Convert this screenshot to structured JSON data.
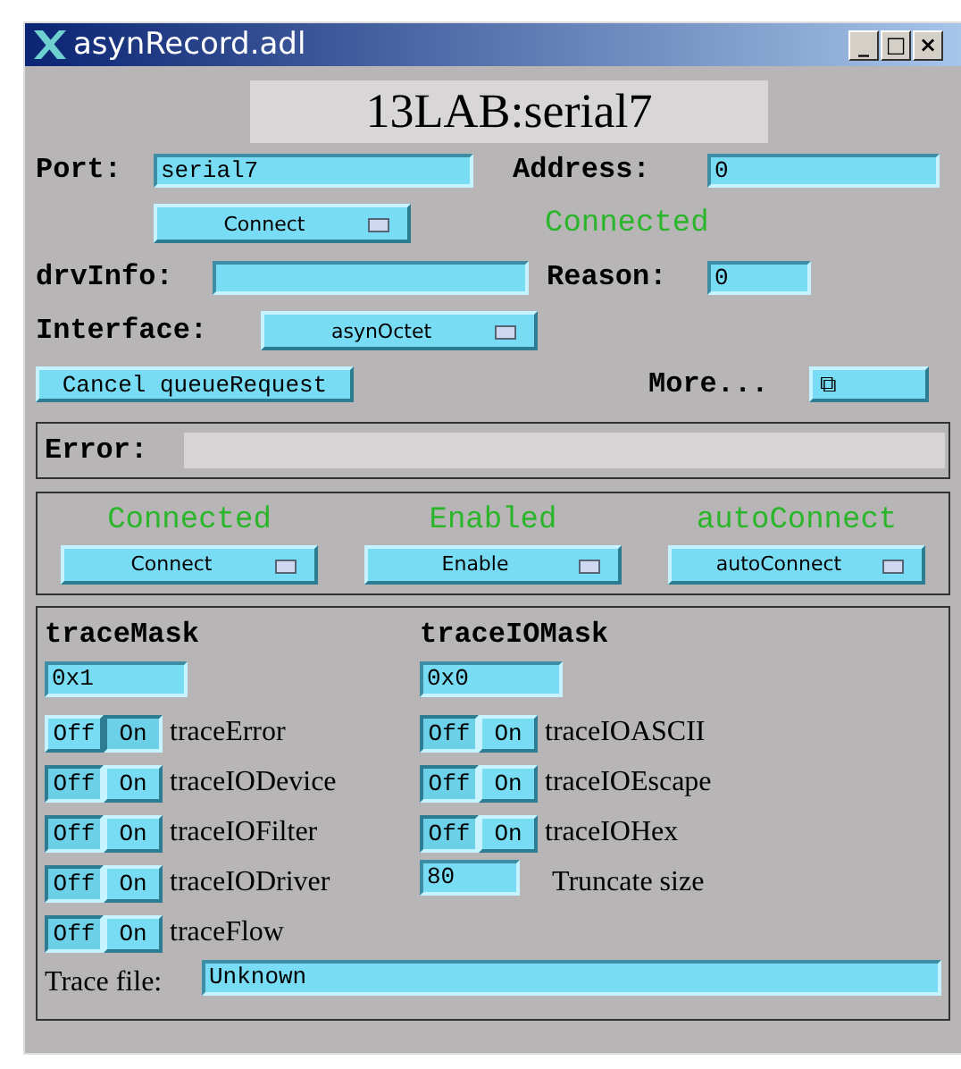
{
  "window": {
    "title": "asynRecord.adl",
    "controls": [
      "_",
      "□",
      "×"
    ]
  },
  "record_name": "13LAB:serial7",
  "port": {
    "label": "Port:",
    "value": "serial7"
  },
  "address": {
    "label": "Address:",
    "value": "0"
  },
  "connect_menu": "Connect",
  "connection_status": "Connected",
  "drvinfo": {
    "label": "drvInfo:"
  },
  "reason": {
    "label": "Reason:",
    "value": "0"
  },
  "interface": {
    "label": "Interface:",
    "menu": "asynOctet"
  },
  "cancel_button": "Cancel queueRequest",
  "more": {
    "label": "More...",
    "button": "⧉"
  },
  "error": {
    "label": "Error:"
  },
  "status_columns": [
    {
      "status": "Connected",
      "menu": "Connect"
    },
    {
      "status": "Enabled",
      "menu": "Enable"
    },
    {
      "status": "autoConnect",
      "menu": "autoConnect"
    }
  ],
  "trace_mask": {
    "title": "traceMask",
    "value": "0x1",
    "toggles": [
      {
        "off": "Off",
        "on_label": "On",
        "label": "traceError",
        "on": true
      },
      {
        "off": "Off",
        "on_label": "On",
        "label": "traceIODevice",
        "on": false
      },
      {
        "off": "Off",
        "on_label": "On",
        "label": "traceIOFilter",
        "on": false
      },
      {
        "off": "Off",
        "on_label": "On",
        "label": "traceIODriver",
        "on": false
      },
      {
        "off": "Off",
        "on_label": "On",
        "label": "traceFlow",
        "on": false
      }
    ]
  },
  "trace_io_mask": {
    "title": "traceIOMask",
    "value": "0x0",
    "toggles": [
      {
        "off": "Off",
        "on_label": "On",
        "label": "traceIOASCII",
        "on": false
      },
      {
        "off": "Off",
        "on_label": "On",
        "label": "traceIOEscape",
        "on": false
      },
      {
        "off": "Off",
        "on_label": "On",
        "label": "traceIOHex",
        "on": false
      }
    ],
    "truncate": {
      "value": "80",
      "label": "Truncate size"
    }
  },
  "trace_file": {
    "label": "Trace file:",
    "value": "Unknown"
  }
}
